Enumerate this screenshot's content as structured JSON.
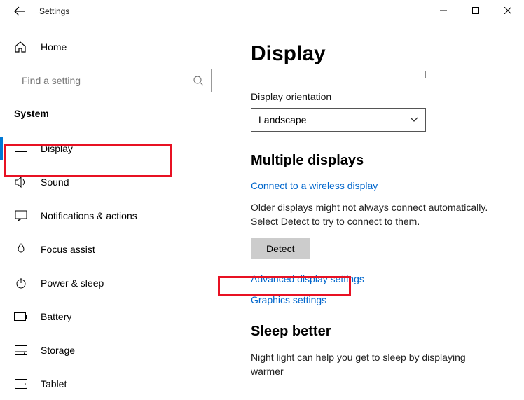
{
  "window": {
    "title": "Settings"
  },
  "sidebar": {
    "home": "Home",
    "searchPlaceholder": "Find a setting",
    "sectionLabel": "System",
    "items": [
      {
        "label": "Display"
      },
      {
        "label": "Sound"
      },
      {
        "label": "Notifications & actions"
      },
      {
        "label": "Focus assist"
      },
      {
        "label": "Power & sleep"
      },
      {
        "label": "Battery"
      },
      {
        "label": "Storage"
      },
      {
        "label": "Tablet"
      }
    ]
  },
  "main": {
    "heading": "Display",
    "orientationLabel": "Display orientation",
    "orientationValue": "Landscape",
    "multiHeading": "Multiple displays",
    "wirelessLink": "Connect to a wireless display",
    "detectText": "Older displays might not always connect automatically. Select Detect to try to connect to them.",
    "detectButton": "Detect",
    "advancedLink": "Advanced display settings",
    "graphicsLink": "Graphics settings",
    "sleepHeading": "Sleep better",
    "sleepText": "Night light can help you get to sleep by displaying warmer"
  }
}
